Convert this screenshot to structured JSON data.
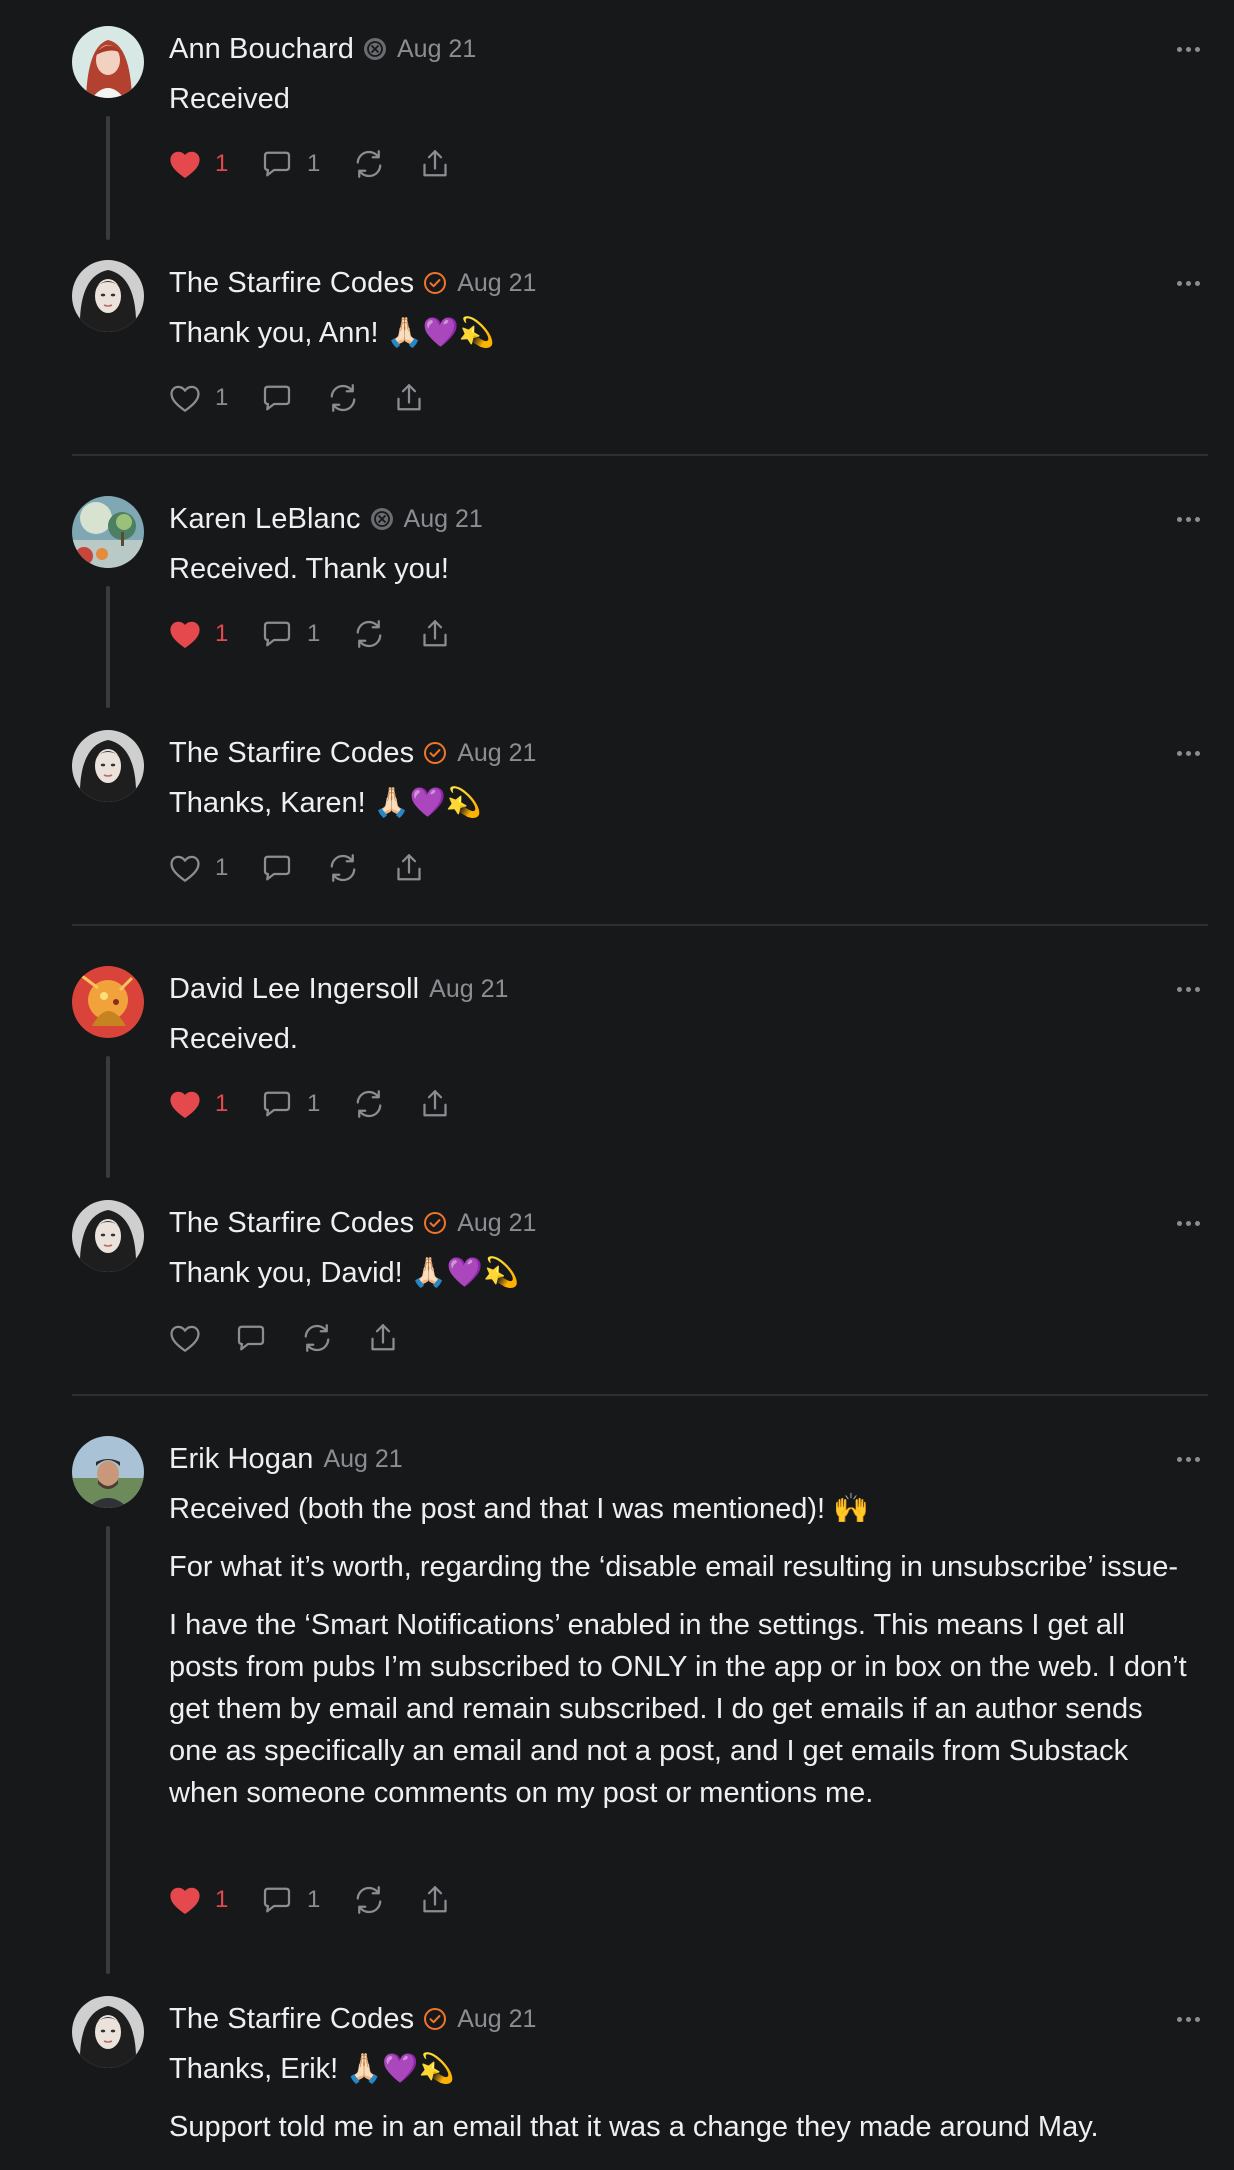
{
  "colors": {
    "background": "#17181a",
    "liked": "#e5484d",
    "verified_badge": "#f0752a",
    "muted": "#8b8d92"
  },
  "icons": {
    "like": "heart-icon",
    "comment": "speech-bubble-icon",
    "restack": "restack-arrows-icon",
    "share": "share-upload-icon",
    "more": "ellipsis-icon",
    "badge_subscriber": "subscriber-badge-icon",
    "badge_verified": "verified-check-icon"
  },
  "comments": [
    {
      "author": "Ann Bouchard",
      "badge": "subscriber",
      "date": "Aug 21",
      "paragraphs": [
        "Received"
      ],
      "likes": "1",
      "liked": true,
      "replies": "1"
    },
    {
      "author": "The Starfire Codes",
      "badge": "verified",
      "date": "Aug 21",
      "paragraphs": [
        "Thank you, Ann! 🙏🏻💜💫"
      ],
      "likes": "1",
      "liked": false,
      "replies": ""
    },
    {
      "author": "Karen LeBlanc",
      "badge": "subscriber",
      "date": "Aug 21",
      "paragraphs": [
        "Received. Thank you!"
      ],
      "likes": "1",
      "liked": true,
      "replies": "1"
    },
    {
      "author": "The Starfire Codes",
      "badge": "verified",
      "date": "Aug 21",
      "paragraphs": [
        "Thanks, Karen! 🙏🏻💜💫"
      ],
      "likes": "1",
      "liked": false,
      "replies": ""
    },
    {
      "author": "David Lee Ingersoll",
      "badge": "",
      "date": "Aug 21",
      "paragraphs": [
        "Received."
      ],
      "likes": "1",
      "liked": true,
      "replies": "1"
    },
    {
      "author": "The Starfire Codes",
      "badge": "verified",
      "date": "Aug 21",
      "paragraphs": [
        "Thank you, David! 🙏🏻💜💫"
      ],
      "likes": "",
      "liked": false,
      "replies": ""
    },
    {
      "author": "Erik Hogan",
      "badge": "",
      "date": "Aug 21",
      "paragraphs": [
        "Received (both the post and that I was mentioned)! 🙌",
        "For what it’s worth, regarding the ‘disable email resulting in unsubscribe’ issue-",
        "I have the ‘Smart Notifications’ enabled in the settings. This means I get all posts from pubs I’m subscribed to ONLY in the app or in box on the web. I don’t get them by email and remain subscribed. I do get emails if an author sends one as specifically an email and not a post, and I get emails from Substack when someone comments on my post or mentions me."
      ],
      "likes": "1",
      "liked": true,
      "replies": "1"
    },
    {
      "author": "The Starfire Codes",
      "badge": "verified",
      "date": "Aug 21",
      "paragraphs": [
        "Thanks, Erik! 🙏🏻💜💫",
        "Support told me in an email that it was a change they made around May."
      ],
      "likes": "",
      "liked": false,
      "replies": ""
    }
  ]
}
